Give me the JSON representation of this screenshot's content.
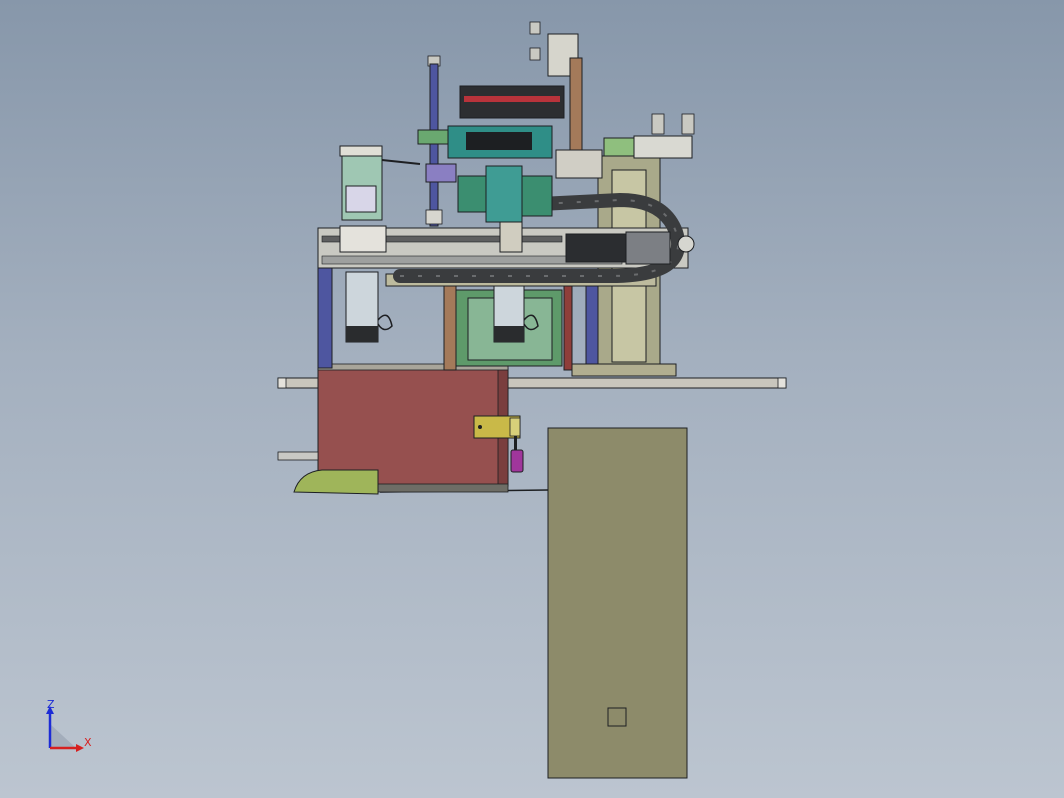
{
  "viewport": {
    "background_top": "#8797aa",
    "background_bottom": "#bcc5d0"
  },
  "triad": {
    "z_label": "Z",
    "x_label": "X",
    "z_color": "#1c2bd6",
    "x_color": "#d62020"
  },
  "colors": {
    "outline": "#1d1f22",
    "cabinet_red": "#96504f",
    "control_box": "#8d8b6a",
    "base_plate": "#c9c6bd",
    "frame_olive": "#a9a98a",
    "frame_green": "#5e9a6a",
    "column_blue": "#4e56a0",
    "teal_part": "#3f9c94",
    "cable_chain": "#3a3c3e",
    "hinge_yellow": "#c9b948",
    "handle_magenta": "#a0369c",
    "brown_bracket": "#a47a5a",
    "motor_light": "#cdd6dc"
  }
}
